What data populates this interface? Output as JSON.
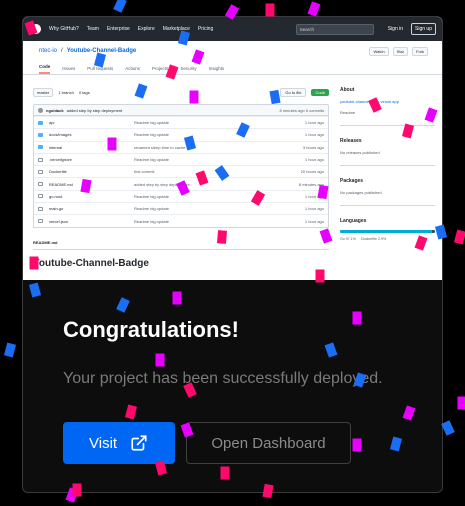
{
  "preview": {
    "nav": [
      "Why GitHub?",
      "Team",
      "Enterprise",
      "Explore",
      "Marketplace",
      "Pricing"
    ],
    "search_placeholder": "Search",
    "sign_in": "Sign in",
    "sign_up": "Sign up",
    "repo_owner": "ntec-io",
    "repo_sep": "/",
    "repo_name": "Youtube-Channel-Badge",
    "watch": "Watch",
    "star": "Star",
    "fork": "Fork",
    "tabs": [
      "Code",
      "Issues",
      "Pull requests",
      "Actions",
      "Projects",
      "Security",
      "Insights"
    ],
    "branch": "master",
    "branch_count": "1 branch",
    "tag_count": "0 tags",
    "go_to_file": "Go to file",
    "code_button": "Code",
    "commit_author": "ngoldack",
    "commit_message": "added step by step deployment",
    "commit_meta": "8 minutes ago  6 commits",
    "files": [
      {
        "name": "api",
        "type": "folder",
        "message": "Readme big update",
        "time": "1 hour ago"
      },
      {
        "name": "docs/images",
        "type": "folder",
        "message": "Readme big update",
        "time": "1 hour ago"
      },
      {
        "name": "internal",
        "type": "folder",
        "message": "renamed sleep time to cache time",
        "time": "3 hours ago"
      },
      {
        "name": ".vercelignore",
        "type": "file",
        "message": "Readme big update",
        "time": "1 hour ago"
      },
      {
        "name": "Dockerfile",
        "type": "file",
        "message": "first commit",
        "time": "20 hours ago"
      },
      {
        "name": "README.md",
        "type": "file",
        "message": "added step by step deployment",
        "time": "8 minutes ago"
      },
      {
        "name": "go.mod",
        "type": "file",
        "message": "Readme big update",
        "time": "1 hour ago"
      },
      {
        "name": "main.go",
        "type": "file",
        "message": "Readme big update",
        "time": "1 hour ago"
      },
      {
        "name": "vercel.json",
        "type": "file",
        "message": "Readme big update",
        "time": "1 hour ago"
      }
    ],
    "readme_label": "README.md",
    "readme_title": "Youtube-Channel-Badge",
    "about_title": "About",
    "about_link": "youtube-channel-stats.vercel.app",
    "readme_link": "Readme",
    "releases_title": "Releases",
    "releases_text": "No releases published",
    "packages_title": "Packages",
    "packages_text": "No packages published",
    "languages_title": "Languages",
    "lang_go": "Go 97.1%",
    "lang_docker": "Dockerfile 2.9%"
  },
  "message": {
    "title": "Congratulations!",
    "subtitle": "Your project has been successfully deployed."
  },
  "buttons": {
    "visit": "Visit",
    "dashboard": "Open Dashboard"
  },
  "colors": {
    "background": "#000000",
    "primary_button": "#0067f4",
    "confetti": [
      "#ff0a6c",
      "#e600ff",
      "#1b6ef3"
    ]
  },
  "icons": {
    "visit_icon": "external-link-icon"
  }
}
